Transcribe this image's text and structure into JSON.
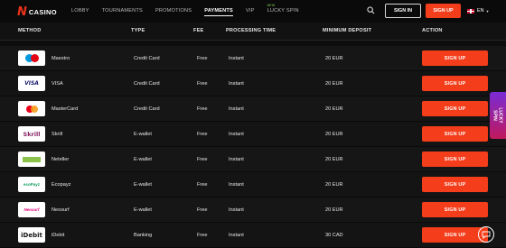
{
  "header": {
    "logo_mark": "N",
    "logo_text": "CASINO",
    "nav": [
      {
        "label": "LOBBY"
      },
      {
        "label": "TOURNAMENTS"
      },
      {
        "label": "PROMOTIONS"
      },
      {
        "label": "PAYMENTS",
        "active": true
      },
      {
        "label": "VIP"
      },
      {
        "label": "LUCKY SPIN",
        "badge": "NEW"
      }
    ],
    "sign_in": "SIGN IN",
    "sign_up": "SIGN UP",
    "language": "EN"
  },
  "table": {
    "columns": [
      "METHOD",
      "TYPE",
      "FEE",
      "PROCESSING TIME",
      "MINIMUM DEPOSIT",
      "ACTION"
    ],
    "rows": [
      {
        "method": "Maestro",
        "type": "Credit Card",
        "fee": "Free",
        "time": "Instant",
        "min": "20 EUR",
        "action": "SIGN UP",
        "logo": "maestro"
      },
      {
        "method": "VISA",
        "type": "Credit Card",
        "fee": "Free",
        "time": "Instant",
        "min": "20 EUR",
        "action": "SIGN UP",
        "logo": "visa"
      },
      {
        "method": "MasterCard",
        "type": "Credit Card",
        "fee": "Free",
        "time": "Instant",
        "min": "20 EUR",
        "action": "SIGN UP",
        "logo": "mastercard"
      },
      {
        "method": "Skrill",
        "type": "E-wallet",
        "fee": "Free",
        "time": "Instant",
        "min": "20 EUR",
        "action": "SIGN UP",
        "logo": "skrill"
      },
      {
        "method": "Neteller",
        "type": "E-wallet",
        "fee": "Free",
        "time": "Instant",
        "min": "20 EUR",
        "action": "SIGN UP",
        "logo": "neteller"
      },
      {
        "method": "Ecopayz",
        "type": "E-wallet",
        "fee": "Free",
        "time": "Instant",
        "min": "20 EUR",
        "action": "SIGN UP",
        "logo": "ecopayz"
      },
      {
        "method": "Neosurf",
        "type": "E-wallet",
        "fee": "Free",
        "time": "Instant",
        "min": "20 EUR",
        "action": "SIGN UP",
        "logo": "neosurf"
      },
      {
        "method": "iDebit",
        "type": "Banking",
        "fee": "Free",
        "time": "Instant",
        "min": "30 CAD",
        "action": "SIGN UP",
        "logo": "idebit"
      }
    ]
  },
  "logo_text": {
    "visa": "VISA",
    "skrill": "Skrill",
    "ecopayz": "ecoPayz",
    "neosurf": "Neosurf",
    "idebit": "iDebit"
  },
  "promo": {
    "line1": "LUCKY",
    "line2": "SPIN"
  },
  "colors": {
    "accent": "#f43d1a",
    "background": "#0d0d0d",
    "row": "#161616"
  }
}
